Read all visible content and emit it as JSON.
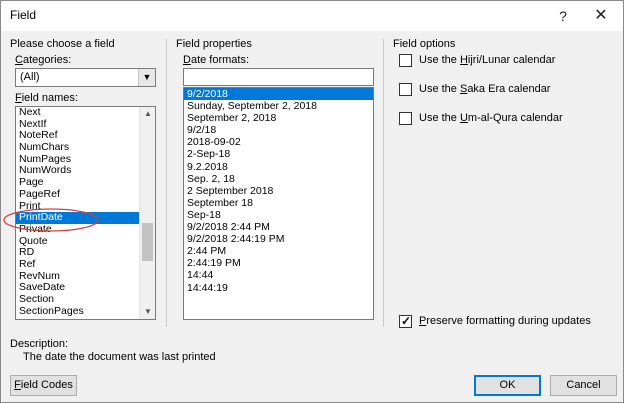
{
  "window": {
    "title": "Field",
    "help_glyph": "?",
    "close_glyph": "✕"
  },
  "left_panel": {
    "heading": "Please choose a field",
    "categories_label": "Categories:",
    "categories_value": "(All)",
    "field_names_label": "Field names:",
    "field_names": [
      "Next",
      "NextIf",
      "NoteRef",
      "NumChars",
      "NumPages",
      "NumWords",
      "Page",
      "PageRef",
      "Print",
      "PrintDate",
      "Private",
      "Quote",
      "RD",
      "Ref",
      "RevNum",
      "SaveDate",
      "Section",
      "SectionPages"
    ],
    "selected_field": "PrintDate"
  },
  "middle_panel": {
    "heading": "Field properties",
    "date_formats_label": "Date formats:",
    "date_format_input": "",
    "date_formats": [
      "9/2/2018",
      "Sunday, September 2, 2018",
      "September 2, 2018",
      "9/2/18",
      "2018-09-02",
      "2-Sep-18",
      "9.2.2018",
      "Sep. 2, 18",
      "2 September 2018",
      "September 18",
      "Sep-18",
      "9/2/2018 2:44 PM",
      "9/2/2018 2:44:19 PM",
      "2:44 PM",
      "2:44:19 PM",
      "14:44",
      "14:44:19"
    ],
    "selected_format": "9/2/2018"
  },
  "right_panel": {
    "heading": "Field options",
    "options": [
      {
        "label": "Use the Hijri/Lunar calendar",
        "checked": false
      },
      {
        "label": "Use the Saka Era calendar",
        "checked": false
      },
      {
        "label": "Use the Um-al-Qura calendar",
        "checked": false
      }
    ],
    "preserve_formatting": {
      "label": "Preserve formatting during updates",
      "checked": true
    }
  },
  "description": {
    "label": "Description:",
    "text": "The date the document was last printed"
  },
  "buttons": {
    "field_codes": "Field Codes",
    "ok": "OK",
    "cancel": "Cancel"
  },
  "icons": {
    "scroll_up": "up-arrow-icon",
    "scroll_down": "down-arrow-icon",
    "dropdown": "chevron-down-icon"
  },
  "colors": {
    "selection": "#0078d7",
    "annotation": "#d04040"
  }
}
